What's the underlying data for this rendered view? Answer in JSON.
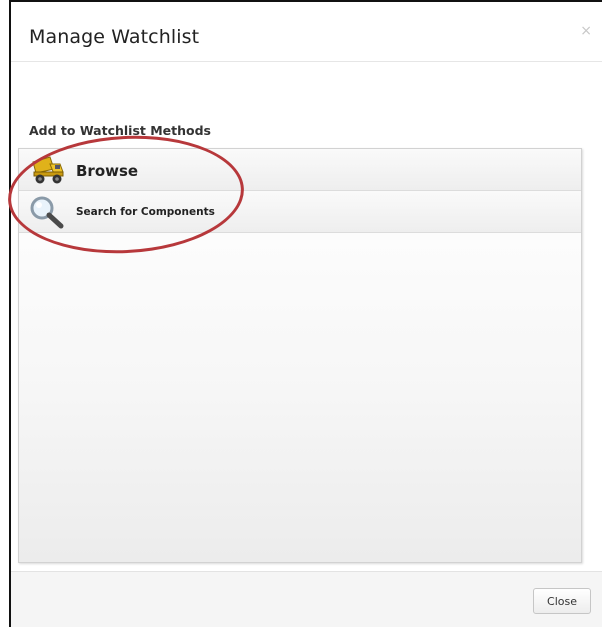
{
  "modal": {
    "title": "Manage Watchlist",
    "close_x": "×"
  },
  "section": {
    "title": "Add to Watchlist Methods"
  },
  "methods": [
    {
      "label": "Browse",
      "icon": "dump-truck-icon"
    },
    {
      "label": "Search for Components",
      "icon": "magnifier-icon"
    }
  ],
  "footer": {
    "close_label": "Close"
  },
  "colors": {
    "annotation": "#b7383b",
    "truck": "#e0b21a"
  }
}
